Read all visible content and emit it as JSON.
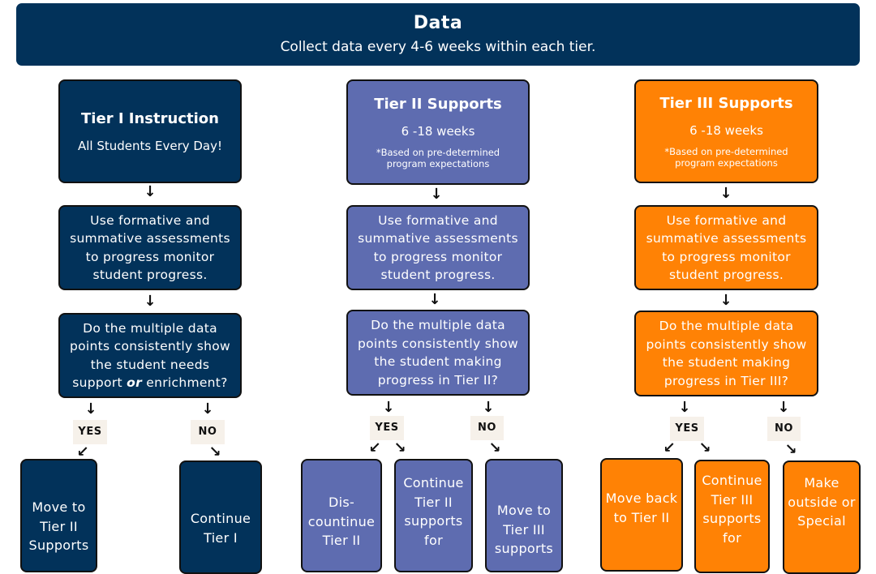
{
  "banner": {
    "title": "Data",
    "subtitle": "Collect data every 4-6 weeks within each tier."
  },
  "colors": {
    "tier1": "#02325a",
    "tier2": "#5e6cb0",
    "tier3": "#ff8205",
    "label_bg": "#f6f1ea"
  },
  "tiers": [
    {
      "title": "Tier I Instruction",
      "line": "All Students Every Day!",
      "monitor": "Use formative and summative assessments to progress monitor student progress.",
      "question_pre": "Do the multiple data points consistently show the student needs support ",
      "question_em": "or",
      "question_post": " enrichment?",
      "yes_label": "YES",
      "no_label": "NO",
      "outcomes": [
        "Move to Tier II Supports",
        "Continue Tier I"
      ]
    },
    {
      "title": "Tier II Supports",
      "line": "6 -18  weeks",
      "note": "*Based on pre-determined program expectations",
      "monitor": "Use formative and summative assessments to progress monitor student progress.",
      "question": "Do the multiple data points consistently show the student making progress in Tier II?",
      "yes_label": "YES",
      "no_label": "NO",
      "outcomes": [
        "Dis- countinue Tier II",
        "Continue Tier II supports for",
        "Move to Tier III supports"
      ]
    },
    {
      "title": "Tier III Supports",
      "line": "6 -18  weeks",
      "note": "*Based on pre-determined program expectations",
      "monitor": "Use formative and summative assessments to progress monitor student progress.",
      "question": "Do the multiple data points consistently show the student making progress in Tier III?",
      "yes_label": "YES",
      "no_label": "NO",
      "outcomes": [
        "Move back to Tier II",
        "Continue Tier III supports for",
        "Make outside or Special"
      ]
    }
  ],
  "icons": {
    "down": "↓",
    "down_left": "↙",
    "down_right": "↘"
  }
}
